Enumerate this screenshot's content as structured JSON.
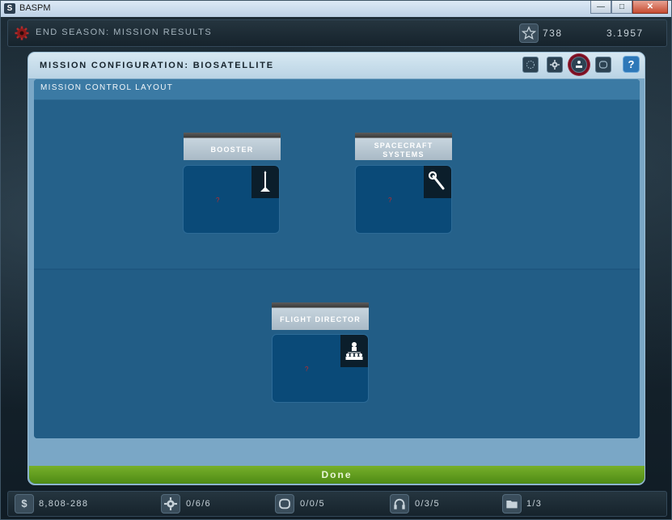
{
  "window": {
    "title": "BASPM",
    "min": "—",
    "max": "□",
    "close": "✕"
  },
  "topbar": {
    "season": "End Season: Mission Results",
    "stars": "738",
    "year": "3.1957"
  },
  "panel": {
    "title": "Mission Configuration: Biosatellite",
    "help": "?"
  },
  "layout": {
    "title": "Mission Control Layout",
    "slots": [
      {
        "label": "Booster",
        "mark": "?"
      },
      {
        "label": "Spacecraft Systems",
        "mark": "?"
      },
      {
        "label": "Flight Director",
        "mark": "?"
      }
    ]
  },
  "done_label": "Done",
  "bottombar": {
    "money_icon": "$",
    "money": "8,808-288",
    "engineers": "0/6/6",
    "crew": "0/0/5",
    "comm": "0/3/5",
    "files": "1/3"
  },
  "icons": {
    "tool1": "circle-dot-icon",
    "tool2": "gear-icon",
    "tool3": "org-chart-icon",
    "tool4": "rounded-square-icon",
    "booster": "rocket-icon",
    "systems": "wrench-icon",
    "director": "team-icon"
  },
  "colors": {
    "done": "#5e9a1c",
    "highlight": "#7a0f22",
    "panel": "#7aa7c6"
  }
}
